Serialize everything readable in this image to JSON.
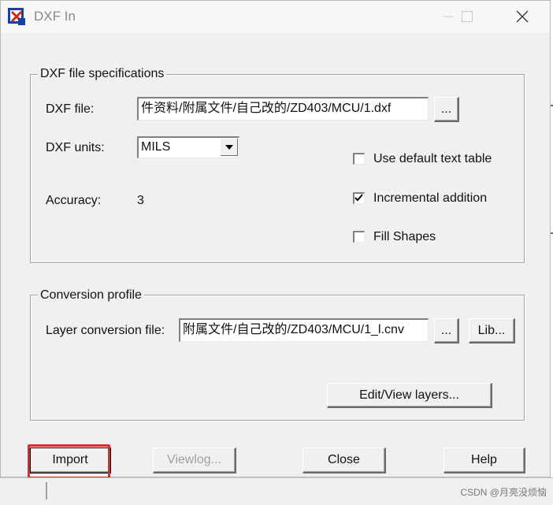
{
  "window": {
    "title": "DXF In"
  },
  "file_group": {
    "legend": "DXF file specifications",
    "dxf_file_label": "DXF file:",
    "dxf_file_value": "件资料/附属文件/自己改的/ZD403/MCU/1.dxf",
    "browse_label": "...",
    "units_label": "DXF units:",
    "units_value": "MILS",
    "accuracy_label": "Accuracy:",
    "accuracy_value": "3",
    "use_default_text_table": {
      "label": "Use default text table",
      "checked": false
    },
    "incremental_addition": {
      "label": "Incremental addition",
      "checked": true
    },
    "fill_shapes": {
      "label": "Fill Shapes",
      "checked": false
    }
  },
  "profile_group": {
    "legend": "Conversion profile",
    "layer_file_label": "Layer conversion file:",
    "layer_file_value": "附属文件/自己改的/ZD403/MCU/1_l.cnv",
    "browse_label": "...",
    "lib_label": "Lib...",
    "edit_view_label": "Edit/View layers..."
  },
  "buttons": {
    "import": "Import",
    "viewlog": "Viewlog...",
    "close": "Close",
    "help": "Help"
  },
  "watermark": "CSDN @月亮没烦恼",
  "colors": {
    "highlight": "#e8252a"
  }
}
